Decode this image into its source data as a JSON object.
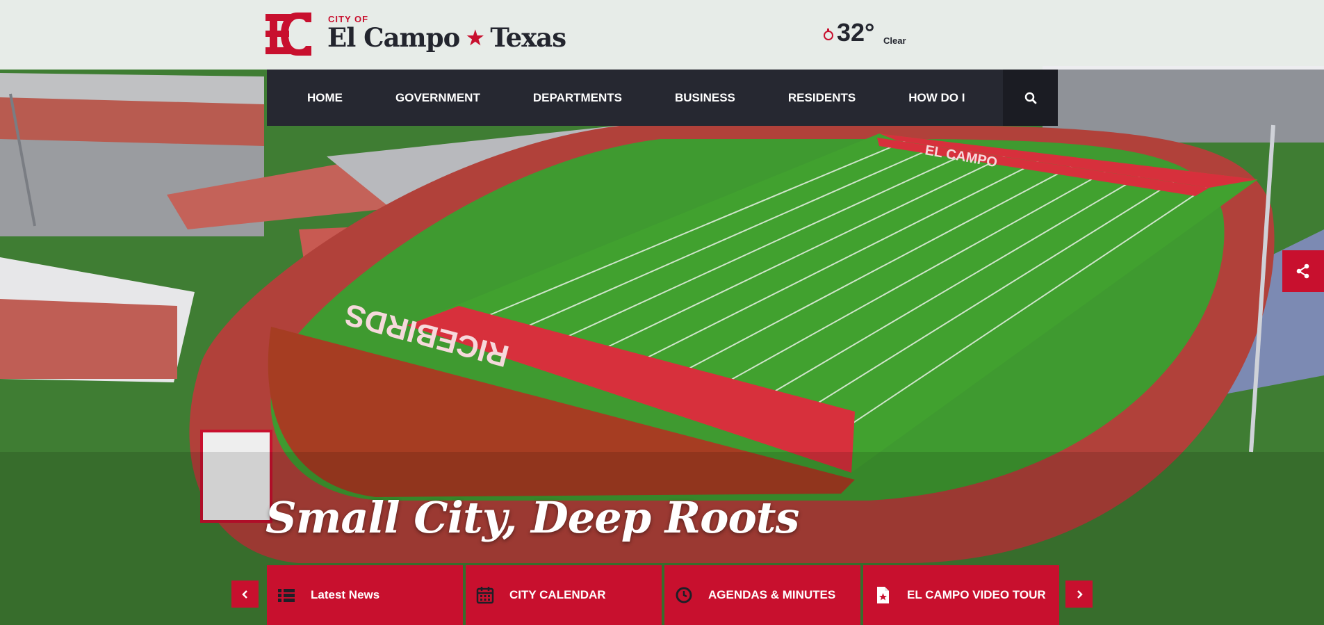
{
  "header": {
    "city_of": "CITY OF",
    "city_name": "El Campo",
    "star": "★",
    "state": "Texas",
    "weather": {
      "temperature": "32°",
      "condition": "Clear",
      "icon": "weather-sun-icon"
    }
  },
  "nav": {
    "items": [
      {
        "label": "HOME"
      },
      {
        "label": "GOVERNMENT"
      },
      {
        "label": "DEPARTMENTS"
      },
      {
        "label": "BUSINESS"
      },
      {
        "label": "RESIDENTS"
      },
      {
        "label": "HOW DO I"
      }
    ],
    "search_icon": "search-icon"
  },
  "hero": {
    "headline": "Small City, Deep Roots",
    "field_endzone_top": "EL CAMPO",
    "field_endzone_bottom": "RICEBIRDS"
  },
  "quick_links": [
    {
      "label": "Latest News",
      "icon": "list-icon"
    },
    {
      "label": "CITY CALENDAR",
      "icon": "calendar-icon"
    },
    {
      "label": "AGENDAS & MINUTES",
      "icon": "clock-icon"
    },
    {
      "label": "EL CAMPO VIDEO TOUR",
      "icon": "document-star-icon"
    }
  ],
  "colors": {
    "brand_red": "#c8102e",
    "nav_dark": "#262831",
    "header_bg": "#f4f4f6"
  },
  "share": {
    "icon": "share-icon"
  }
}
